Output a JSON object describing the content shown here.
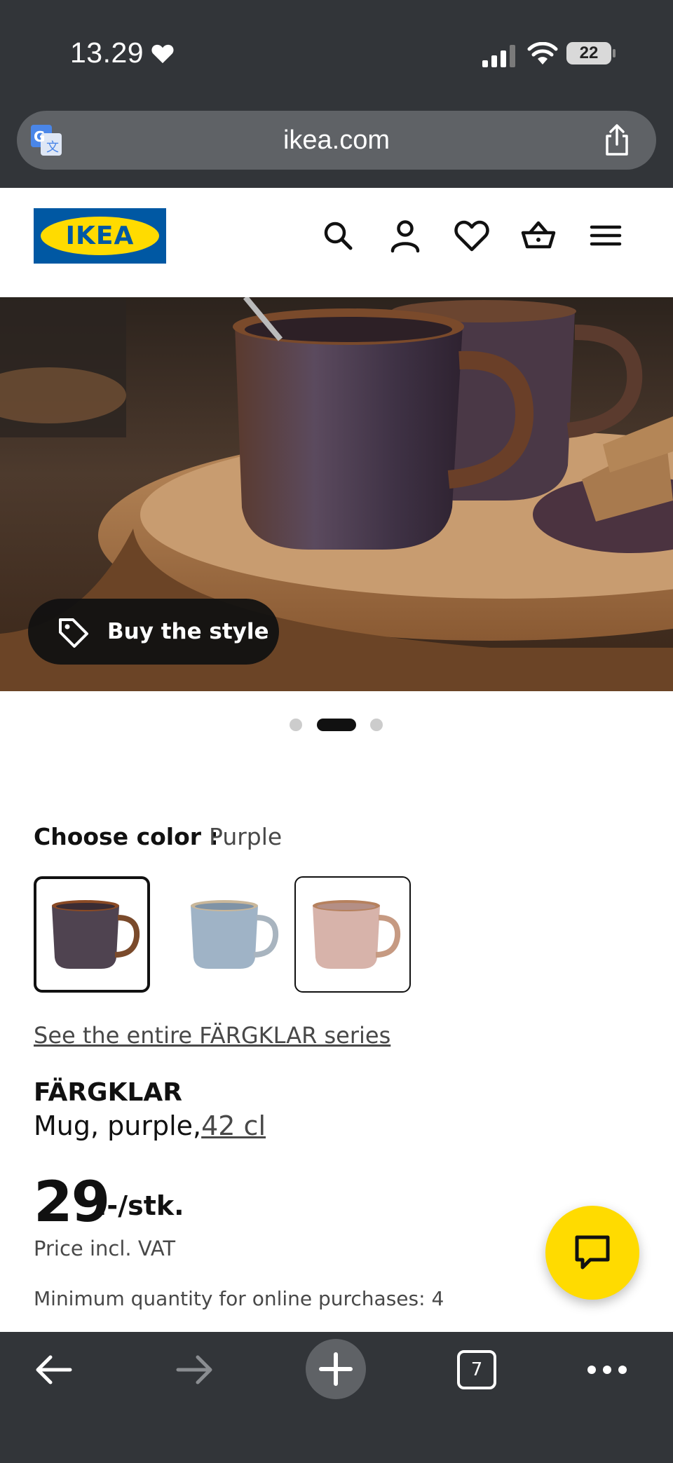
{
  "status_bar": {
    "time": "13.29",
    "battery": "22"
  },
  "browser": {
    "url": "ikea.com",
    "tab_count": "7"
  },
  "header": {
    "logo_text": "IKEA"
  },
  "hero": {
    "buy_style_label": "Buy the style",
    "slide_count": 3,
    "active_slide": 2
  },
  "color_picker": {
    "label": "Choose color :",
    "selected": "Purple",
    "swatches": [
      {
        "name": "purple",
        "selected": true,
        "body": "#4f4350",
        "rim": "#8a4a25"
      },
      {
        "name": "light-blue",
        "selected": false,
        "body": "#9fb3c6",
        "rim": "#c9b79a"
      },
      {
        "name": "pink",
        "selected": false,
        "body": "#d7b3aa",
        "rim": "#b6815e"
      }
    ]
  },
  "product": {
    "series_link": "See the entire FÄRGKLAR series",
    "name": "FÄRGKLAR",
    "description": "Mug, purple,",
    "size": "42 cl",
    "price_integer": "29",
    "price_suffix": ".-/stk.",
    "vat_note": "Price incl. VAT",
    "min_qty_note": "Minimum quantity for online purchases: 4"
  },
  "colors": {
    "ikea_blue": "#0058a3",
    "ikea_yellow": "#ffdb00",
    "chrome_dark": "#323539"
  },
  "icons": [
    "heart-icon",
    "signal-icon",
    "wifi-icon",
    "translate-icon",
    "share-icon",
    "search-icon",
    "user-icon",
    "favorite-icon",
    "cart-icon",
    "menu-icon",
    "tag-icon",
    "chat-icon",
    "back-icon",
    "forward-icon",
    "plus-icon",
    "more-icon"
  ]
}
